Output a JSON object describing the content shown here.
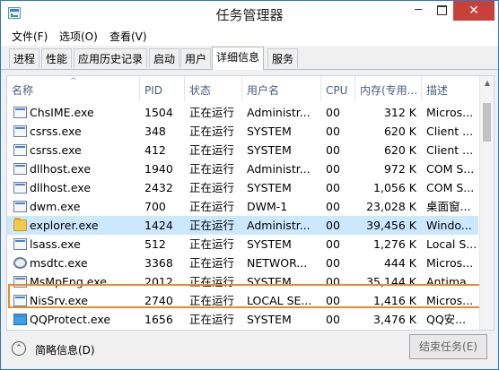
{
  "window": {
    "title": "任务管理器",
    "controls": {
      "minimize": "─",
      "close": "✕"
    }
  },
  "menu": {
    "file": "文件(F)",
    "options": "选项(O)",
    "view": "查看(V)"
  },
  "tabs": [
    "进程",
    "性能",
    "应用历史记录",
    "启动",
    "用户",
    "详细信息",
    "服务"
  ],
  "active_tab": "详细信息",
  "columns": [
    "名称",
    "PID",
    "状态",
    "用户名",
    "CPU",
    "内存(专用...",
    "描述"
  ],
  "rows": [
    {
      "name": "ChsIME.exe",
      "pid": "1504",
      "status": "正在运行",
      "user": "Administr...",
      "cpu": "00",
      "memory": "312 K",
      "desc": "Micros...",
      "icon": "window-icon"
    },
    {
      "name": "csrss.exe",
      "pid": "348",
      "status": "正在运行",
      "user": "SYSTEM",
      "cpu": "00",
      "memory": "620 K",
      "desc": "Client ...",
      "icon": "window-icon"
    },
    {
      "name": "csrss.exe",
      "pid": "412",
      "status": "正在运行",
      "user": "SYSTEM",
      "cpu": "00",
      "memory": "620 K",
      "desc": "Client ...",
      "icon": "window-icon"
    },
    {
      "name": "dllhost.exe",
      "pid": "1940",
      "status": "正在运行",
      "user": "Administr...",
      "cpu": "00",
      "memory": "972 K",
      "desc": "COM S...",
      "icon": "window-icon"
    },
    {
      "name": "dllhost.exe",
      "pid": "2432",
      "status": "正在运行",
      "user": "SYSTEM",
      "cpu": "00",
      "memory": "1,056 K",
      "desc": "COM S...",
      "icon": "window-icon"
    },
    {
      "name": "dwm.exe",
      "pid": "700",
      "status": "正在运行",
      "user": "DWM-1",
      "cpu": "00",
      "memory": "23,028 K",
      "desc": "桌面窗...",
      "icon": "window-icon"
    },
    {
      "name": "explorer.exe",
      "pid": "1424",
      "status": "正在运行",
      "user": "Administr...",
      "cpu": "00",
      "memory": "39,456 K",
      "desc": "Windo...",
      "icon": "folder-icon",
      "selected": true
    },
    {
      "name": "lsass.exe",
      "pid": "512",
      "status": "正在运行",
      "user": "SYSTEM",
      "cpu": "00",
      "memory": "1,276 K",
      "desc": "Local S...",
      "icon": "window-icon"
    },
    {
      "name": "msdtc.exe",
      "pid": "3368",
      "status": "正在运行",
      "user": "NETWOR...",
      "cpu": "00",
      "memory": "444 K",
      "desc": "Micros...",
      "icon": "gear-icon"
    },
    {
      "name": "MsMpEng.exe",
      "pid": "2012",
      "status": "正在运行",
      "user": "SYSTEM",
      "cpu": "00",
      "memory": "35,144 K",
      "desc": "Antima...",
      "icon": "window-icon"
    },
    {
      "name": "NisSrv.exe",
      "pid": "2740",
      "status": "正在运行",
      "user": "LOCAL SE...",
      "cpu": "00",
      "memory": "1,416 K",
      "desc": "Micros...",
      "icon": "window-icon"
    },
    {
      "name": "QQProtect.exe",
      "pid": "1656",
      "status": "正在运行",
      "user": "SYSTEM",
      "cpu": "00",
      "memory": "3,476 K",
      "desc": "QQ安...",
      "icon": "qq-icon"
    }
  ],
  "footer": {
    "fewer_details": "简略信息(D)",
    "end_task": "结束任务(E)"
  },
  "colors": {
    "selection": "#cce8ff",
    "highlight_border": "#e98a2c",
    "close_button": "#c7403a"
  }
}
